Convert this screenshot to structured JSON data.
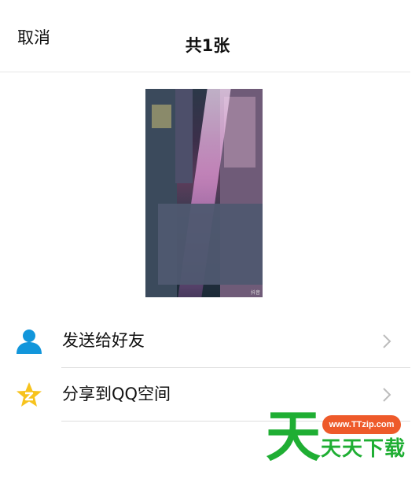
{
  "header": {
    "cancel_label": "取消",
    "title": "共1张"
  },
  "preview": {
    "watermark_text": "抖音"
  },
  "menu": {
    "items": [
      {
        "label": "发送给好友",
        "icon": "person-icon"
      },
      {
        "label": "分享到QQ空间",
        "icon": "qzone-star-icon"
      }
    ]
  },
  "watermark": {
    "big_char": "天",
    "url": "www.TTzip.com",
    "text": "天天下载"
  },
  "colors": {
    "accent_blue": "#1296db",
    "star_yellow": "#f7c31d",
    "logo_green": "#1fae33",
    "logo_orange": "#ee5a2a"
  }
}
